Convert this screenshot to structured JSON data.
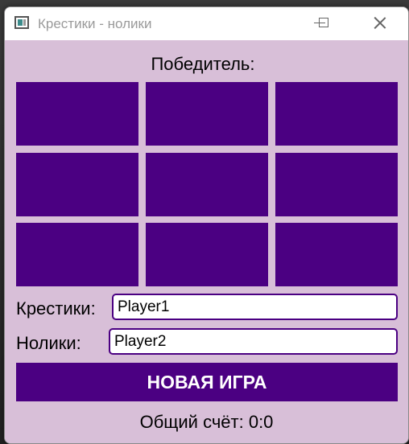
{
  "window": {
    "title": "Крестики - нолики",
    "icon": "app-icon",
    "controls": [
      "minimize-icon",
      "maximize-icon",
      "close-icon"
    ]
  },
  "game": {
    "winner_label": "Победитель:",
    "board": [
      "",
      "",
      "",
      "",
      "",
      "",
      "",
      "",
      ""
    ],
    "cell_color": "#4b0082",
    "background_color": "#d8bfd8"
  },
  "players": {
    "crosses_label": "Крестики:",
    "crosses_value": "Player1",
    "noughts_label": "Нолики:",
    "noughts_value": "Player2"
  },
  "new_game_label": "НОВАЯ ИГРА",
  "score_text": "Общий счёт: 0:0"
}
